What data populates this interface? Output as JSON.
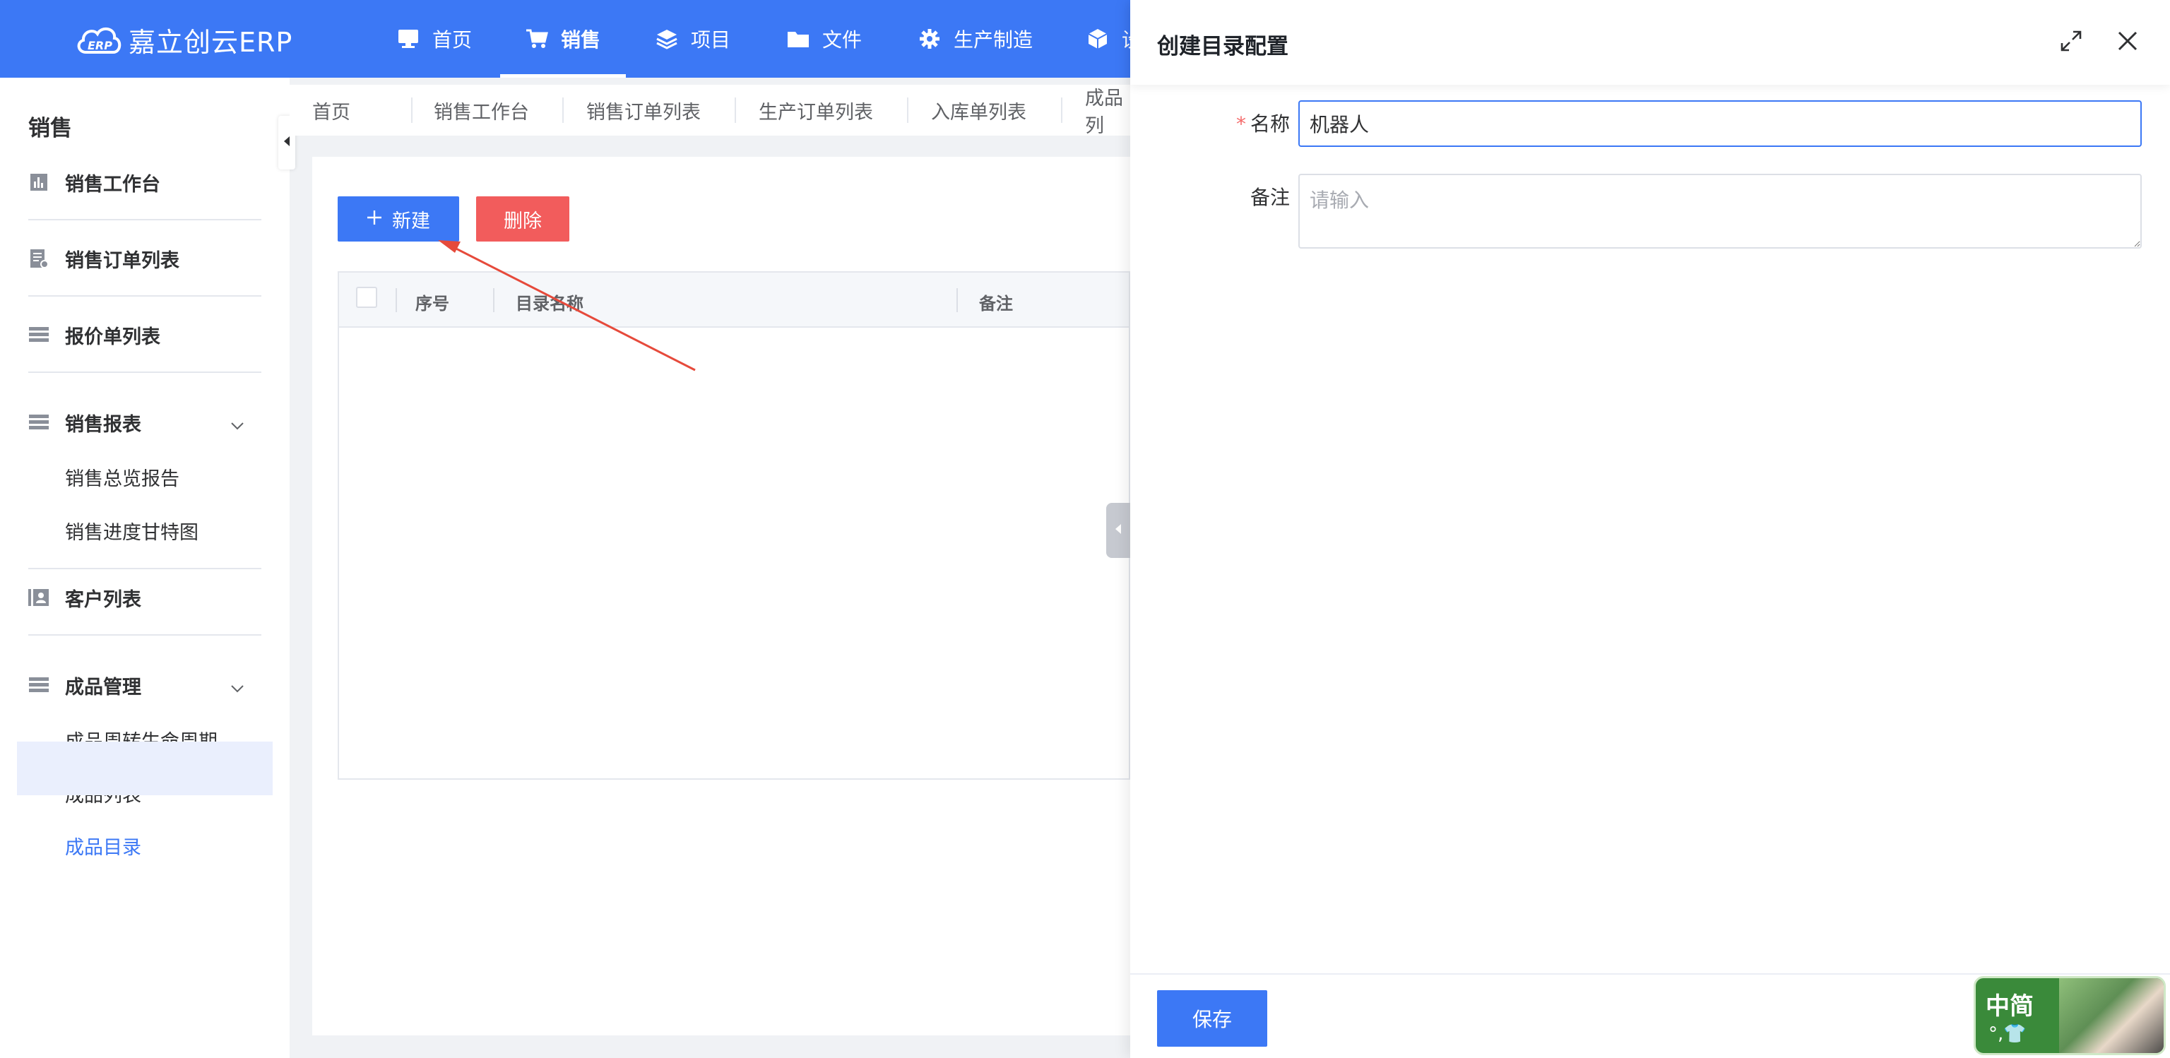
{
  "topbar": {
    "brand": "嘉立创云ERP",
    "logo_text": "ERP",
    "nav": [
      {
        "label": "首页",
        "icon": "monitor-icon"
      },
      {
        "label": "销售",
        "icon": "cart-icon",
        "active": true
      },
      {
        "label": "项目",
        "icon": "layers-icon"
      },
      {
        "label": "文件",
        "icon": "folder-icon"
      },
      {
        "label": "生产制造",
        "icon": "gear-icon"
      },
      {
        "label": "设",
        "icon": "box-icon"
      }
    ],
    "accent": "#3c78f5"
  },
  "sidebar": {
    "title": "销售",
    "items": [
      {
        "label": "销售工作台",
        "icon": "chart-icon"
      },
      {
        "label": "销售订单列表",
        "icon": "document-icon"
      },
      {
        "label": "报价单列表",
        "icon": "list-icon"
      },
      {
        "label": "销售报表",
        "icon": "list-icon",
        "expanded": true,
        "children": [
          "销售总览报告",
          "销售进度甘特图"
        ]
      },
      {
        "label": "客户列表",
        "icon": "contacts-icon"
      },
      {
        "label": "成品管理",
        "icon": "list-icon",
        "expanded": true,
        "children": [
          "成品周转生命周期",
          "成品列表",
          "成品目录"
        ]
      }
    ],
    "active_item": "成品目录"
  },
  "tabs": [
    "首页",
    "销售工作台",
    "销售订单列表",
    "生产订单列表",
    "入库单列表",
    "成品列"
  ],
  "toolbar": {
    "new_label": "新建",
    "delete_label": "删除"
  },
  "table": {
    "columns": [
      "序号",
      "目录名称",
      "备注"
    ],
    "rows": []
  },
  "drawer": {
    "title": "创建目录配置",
    "fields": {
      "name_label": "名称",
      "name_value": "机器人",
      "remark_label": "备注",
      "remark_placeholder": "请输入"
    },
    "save_label": "保存"
  },
  "ime": {
    "label": "中简",
    "symbols": "°,👕"
  }
}
